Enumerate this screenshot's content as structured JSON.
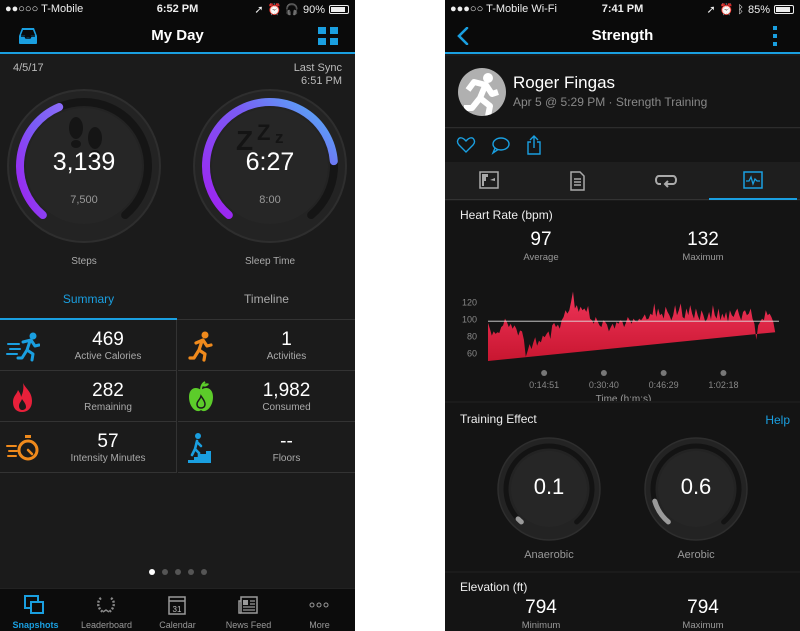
{
  "left": {
    "status": {
      "carrier": "●●○○○ T-Mobile",
      "time": "6:52 PM",
      "battery": "90%",
      "battery_level": 0.9
    },
    "nav": {
      "title": "My Day",
      "left_icon": "inbox-tray-icon",
      "right_icon": "grid-icon"
    },
    "date": "4/5/17",
    "sync_label": "Last Sync",
    "sync_time": "6:51 PM",
    "rings": [
      {
        "value": "3,139",
        "goal": "7,500",
        "label": "Steps",
        "progress": 0.4185
      },
      {
        "value": "6:27",
        "goal": "8:00",
        "label": "Sleep Time",
        "progress": 0.806
      }
    ],
    "tabs": [
      {
        "label": "Summary",
        "active": true
      },
      {
        "label": "Timeline",
        "active": false
      }
    ],
    "stats": [
      {
        "value": "469",
        "label": "Active Calories",
        "icon": "running-fast-icon",
        "color": "#1a9fe0"
      },
      {
        "value": "1",
        "label": "Activities",
        "icon": "runner-icon",
        "color": "#f08a1c"
      },
      {
        "value": "282",
        "label": "Remaining",
        "icon": "flame-icon",
        "color": "#e8203a"
      },
      {
        "value": "1,982",
        "label": "Consumed",
        "icon": "apple-icon",
        "color": "#5ccc2a"
      },
      {
        "value": "57",
        "label": "Intensity Minutes",
        "icon": "stopwatch-icon",
        "color": "#f08a1c"
      },
      {
        "value": "--",
        "label": "Floors",
        "icon": "stairs-icon",
        "color": "#1a9fe0"
      }
    ],
    "page_dots": {
      "count": 5,
      "active": 0
    },
    "tabbar": [
      {
        "label": "Snapshots",
        "icon": "snapshots-icon",
        "active": true
      },
      {
        "label": "Leaderboard",
        "icon": "laurel-icon",
        "active": false
      },
      {
        "label": "Calendar",
        "icon": "calendar-icon",
        "active": false,
        "day": "31"
      },
      {
        "label": "News Feed",
        "icon": "newspaper-icon",
        "active": false
      },
      {
        "label": "More",
        "icon": "more-dots-icon",
        "active": false
      }
    ]
  },
  "right": {
    "status": {
      "carrier": "●●●○○ T-Mobile Wi-Fi",
      "time": "7:41 PM",
      "battery": "85%",
      "battery_level": 0.85
    },
    "nav": {
      "title": "Strength",
      "left_icon": "back-chevron-icon",
      "right_icon": "kebab-menu-icon"
    },
    "profile": {
      "name": "Roger Fingas",
      "subtitle": "Apr 5 @ 5:29 PM · Strength Training"
    },
    "actions": [
      "heart-icon",
      "comment-icon",
      "share-icon"
    ],
    "subtabs": [
      {
        "icon": "map-icon",
        "active": false
      },
      {
        "icon": "details-icon",
        "active": false
      },
      {
        "icon": "laps-icon",
        "active": false
      },
      {
        "icon": "charts-icon",
        "active": true
      }
    ],
    "heart_rate": {
      "title": "Heart Rate (bpm)",
      "average": "97",
      "average_label": "Average",
      "maximum": "132",
      "maximum_label": "Maximum"
    },
    "training_effect": {
      "title": "Training Effect",
      "help": "Help",
      "anaerobic": {
        "value": "0.1",
        "label": "Anaerobic",
        "fraction": 0.02
      },
      "aerobic": {
        "value": "0.6",
        "label": "Aerobic",
        "fraction": 0.12
      }
    },
    "elevation": {
      "title": "Elevation (ft)",
      "minimum": "794",
      "minimum_label": "Minimum",
      "maximum": "794",
      "maximum_label": "Maximum"
    }
  },
  "chart_data": {
    "type": "area",
    "title": "Heart Rate (bpm)",
    "xlabel": "Time (h:m:s)",
    "ylabel": "",
    "y_ticks": [
      "120",
      "100",
      "80",
      "60"
    ],
    "y_tick_values": [
      120,
      100,
      80,
      60
    ],
    "x_tick_labels": [
      "0:14:51",
      "0:30:40",
      "0:46:29",
      "1:02:18"
    ],
    "x_tick_minutes": [
      14.85,
      30.67,
      46.48,
      62.3
    ],
    "ylim": [
      50,
      135
    ],
    "xlim_minutes": [
      0,
      77
    ],
    "average_line": 97,
    "series": [
      {
        "name": "Heart Rate",
        "color": "#e0254a",
        "x_minutes": [
          0,
          0.5,
          1,
          1.5,
          2,
          2.5,
          3,
          3.5,
          4,
          4.5,
          5,
          5.5,
          6,
          6.5,
          7,
          7.5,
          8,
          8.5,
          9,
          9.5,
          10,
          10.5,
          11,
          11.5,
          12,
          12.5,
          13,
          13.5,
          14,
          14.5,
          15,
          15.5,
          16,
          16.5,
          17,
          17.5,
          18,
          18.5,
          19,
          19.5,
          20,
          20.5,
          21,
          21.5,
          22,
          22.5,
          23,
          23.5,
          24,
          24.5,
          25,
          25.5,
          26,
          26.5,
          27,
          27.5,
          28,
          28.5,
          29,
          29.5,
          30,
          30.5,
          31,
          31.5,
          32,
          32.5,
          33,
          33.5,
          34,
          34.5,
          35,
          35.5,
          36,
          36.5,
          37,
          37.5,
          38,
          38.5,
          39,
          39.5,
          40,
          40.5,
          41,
          41.5,
          42,
          42.5,
          43,
          43.5,
          44,
          44.5,
          45,
          45.5,
          46,
          46.5,
          47,
          47.5,
          48,
          48.5,
          49,
          49.5,
          50,
          50.5,
          51,
          51.5,
          52,
          52.5,
          53,
          53.5,
          54,
          54.5,
          55,
          55.5,
          56,
          56.5,
          57,
          57.5,
          58,
          58.5,
          59,
          59.5,
          60,
          60.5,
          61,
          61.5,
          62,
          62.5,
          63,
          63.5,
          64,
          64.5,
          65,
          65.5,
          66,
          66.5,
          67,
          67.5,
          68,
          68.5,
          69,
          69.5,
          70,
          70.5,
          71,
          71.5,
          72,
          72.5,
          73,
          73.5,
          74,
          74.5,
          75,
          75.5,
          76,
          76.5,
          77
        ],
        "values": [
          95,
          88,
          80,
          85,
          82,
          84,
          83,
          90,
          92,
          100,
          96,
          90,
          94,
          88,
          92,
          88,
          80,
          86,
          85,
          75,
          55,
          62,
          70,
          64,
          72,
          78,
          68,
          74,
          72,
          80,
          78,
          82,
          85,
          76,
          92,
          95,
          90,
          93,
          88,
          98,
          102,
          110,
          106,
          110,
          120,
          132,
          112,
          116,
          108,
          114,
          110,
          112,
          108,
          115,
          100,
          98,
          94,
          102,
          97,
          92,
          90,
          98,
          96,
          93,
          85,
          90,
          94,
          88,
          96,
          94,
          98,
          97,
          90,
          95,
          102,
          98,
          94,
          100,
          97,
          96,
          100,
          98,
          101,
          105,
          99,
          100,
          106,
          104,
          118,
          102,
          112,
          104,
          106,
          100,
          114,
          108,
          104,
          98,
          104,
          116,
          104,
          110,
          118,
          102,
          100,
          112,
          104,
          116,
          106,
          100,
          112,
          104,
          98,
          110,
          104,
          96,
          100,
          108,
          99,
          116,
          104,
          100,
          112,
          98,
          106,
          100,
          108,
          96,
          110,
          104,
          102,
          108,
          112,
          104,
          98,
          108,
          110,
          104,
          106,
          112,
          100,
          94,
          75,
          92,
          96,
          100,
          98,
          110,
          104,
          106,
          102,
          96,
          84
        ]
      }
    ]
  }
}
